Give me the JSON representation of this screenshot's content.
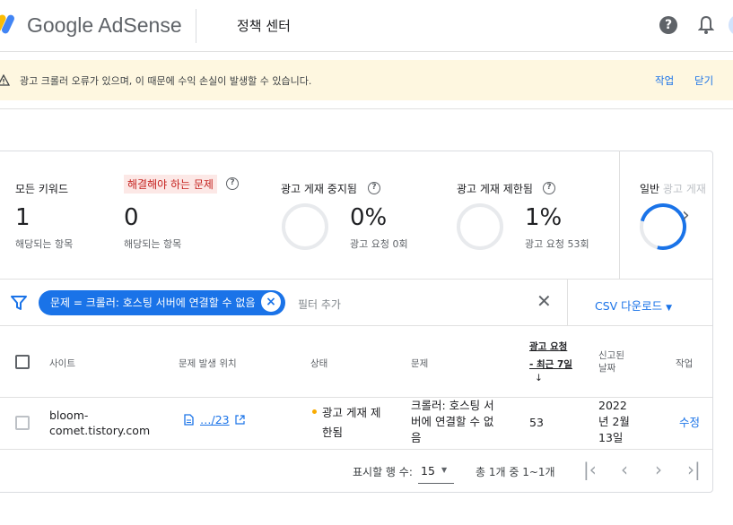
{
  "header": {
    "brand": "Google AdSense",
    "page_title": "정책 센터",
    "help_icon": "?"
  },
  "alert": {
    "message": "광고 크롤러 오류가 있으며, 이 때문에 수익 손실이 발생할 수 있습니다.",
    "action_label": "작업",
    "dismiss_label": "닫기"
  },
  "stats": [
    {
      "label": "모든 키워드",
      "value": "1",
      "sub": "해당되는 항목"
    },
    {
      "label": "해결해야 하는 문제",
      "value": "0",
      "sub": "해당되는 항목"
    },
    {
      "label": "광고 게재 중지됨",
      "value": "0%",
      "sub": "광고 요청 0회"
    },
    {
      "label": "광고 게재 제한됨",
      "value": "1%",
      "sub": "광고 요청 53회"
    },
    {
      "label": "일반",
      "label_faded": "광고 게재"
    }
  ],
  "filter": {
    "chip_label": "문제 = 크롤러: 호스팅 서버에 연결할 수 없음",
    "add_filter": "필터 추가",
    "csv_label": "CSV 다운로드"
  },
  "table": {
    "columns": {
      "site": "사이트",
      "location": "문제 발생 위치",
      "status": "상태",
      "issue": "문제",
      "requests_1": "광고 요청",
      "requests_2": "- 최근 7일",
      "sort_arrow": "↓",
      "reported_1": "신고된",
      "reported_2": "날짜",
      "action": "작업"
    },
    "row": {
      "site_1": "bloom-",
      "site_2": "comet.tistory.com",
      "location": "…/23",
      "status_1": "광고 게재 제",
      "status_2": "한됨",
      "issue_1": "크롤러: 호스팅 서",
      "issue_2": "버에 연결할 수 없",
      "issue_3": "음",
      "requests": "53",
      "date_1": "2022",
      "date_2": "년 2월",
      "date_3": "13일",
      "action": "수정"
    }
  },
  "pagination": {
    "rows_label": "표시할 행 수:",
    "rows_value": "15",
    "range_text": "총 1개 중 1~1개"
  },
  "colors": {
    "accent": "#1a73e8",
    "alert_bg": "#fef7e0",
    "issue_highlight": "#fce8e6"
  }
}
